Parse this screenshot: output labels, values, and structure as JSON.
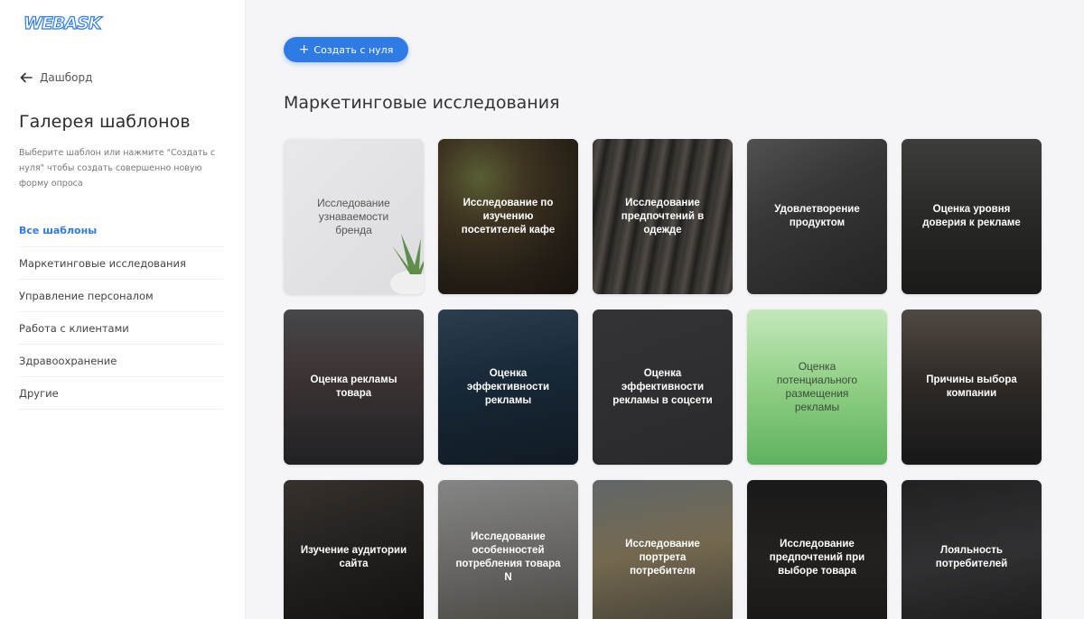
{
  "app": {
    "logo_text": "WEBASK"
  },
  "sidebar": {
    "back_label": "Дашборд",
    "title": "Галерея шаблонов",
    "description": "Выберите шаблон или нажмите \"Создать с нуля\" чтобы создать совершенно новую форму опроса",
    "items": [
      {
        "label": "Все шаблоны",
        "active": true
      },
      {
        "label": "Маркетинговые исследования"
      },
      {
        "label": "Управление персоналом"
      },
      {
        "label": "Работа с клиентами"
      },
      {
        "label": "Здравоохранение"
      },
      {
        "label": "Другие"
      }
    ]
  },
  "main": {
    "create_button_label": "Создать с нуля",
    "section_title": "Маркетинговые исследования",
    "cards": [
      {
        "label": "Исследование узнаваемости бренда",
        "style": "light"
      },
      {
        "label": "Исследование по изучению посетителей кафе",
        "style": "photo"
      },
      {
        "label": "Исследование предпочтений в одежде",
        "style": "photo"
      },
      {
        "label": "Удовлетворение продуктом",
        "style": "photo"
      },
      {
        "label": "Оценка уровня доверия к рекламе",
        "style": "photo"
      },
      {
        "label": "Оценка рекламы товара",
        "style": "photo"
      },
      {
        "label": "Оценка эффективности рекламы",
        "style": "photo"
      },
      {
        "label": "Оценка эффективности рекламы в соцсети",
        "style": "photo"
      },
      {
        "label": "Оценка потенциального размещения рекламы",
        "style": "green"
      },
      {
        "label": "Причины выбора компании",
        "style": "photo"
      },
      {
        "label": "Изучение аудитории сайта",
        "style": "photo"
      },
      {
        "label": "Исследование особенностей потребления товара N",
        "style": "photo"
      },
      {
        "label": "Исследование портрета потребителя",
        "style": "photo"
      },
      {
        "label": "Исследование предпочтений при выборе товара",
        "style": "photo"
      },
      {
        "label": "Лояльность потребителей",
        "style": "photo"
      }
    ]
  },
  "colors": {
    "accent": "#2f7be6",
    "green_card": "#5fb25f"
  }
}
